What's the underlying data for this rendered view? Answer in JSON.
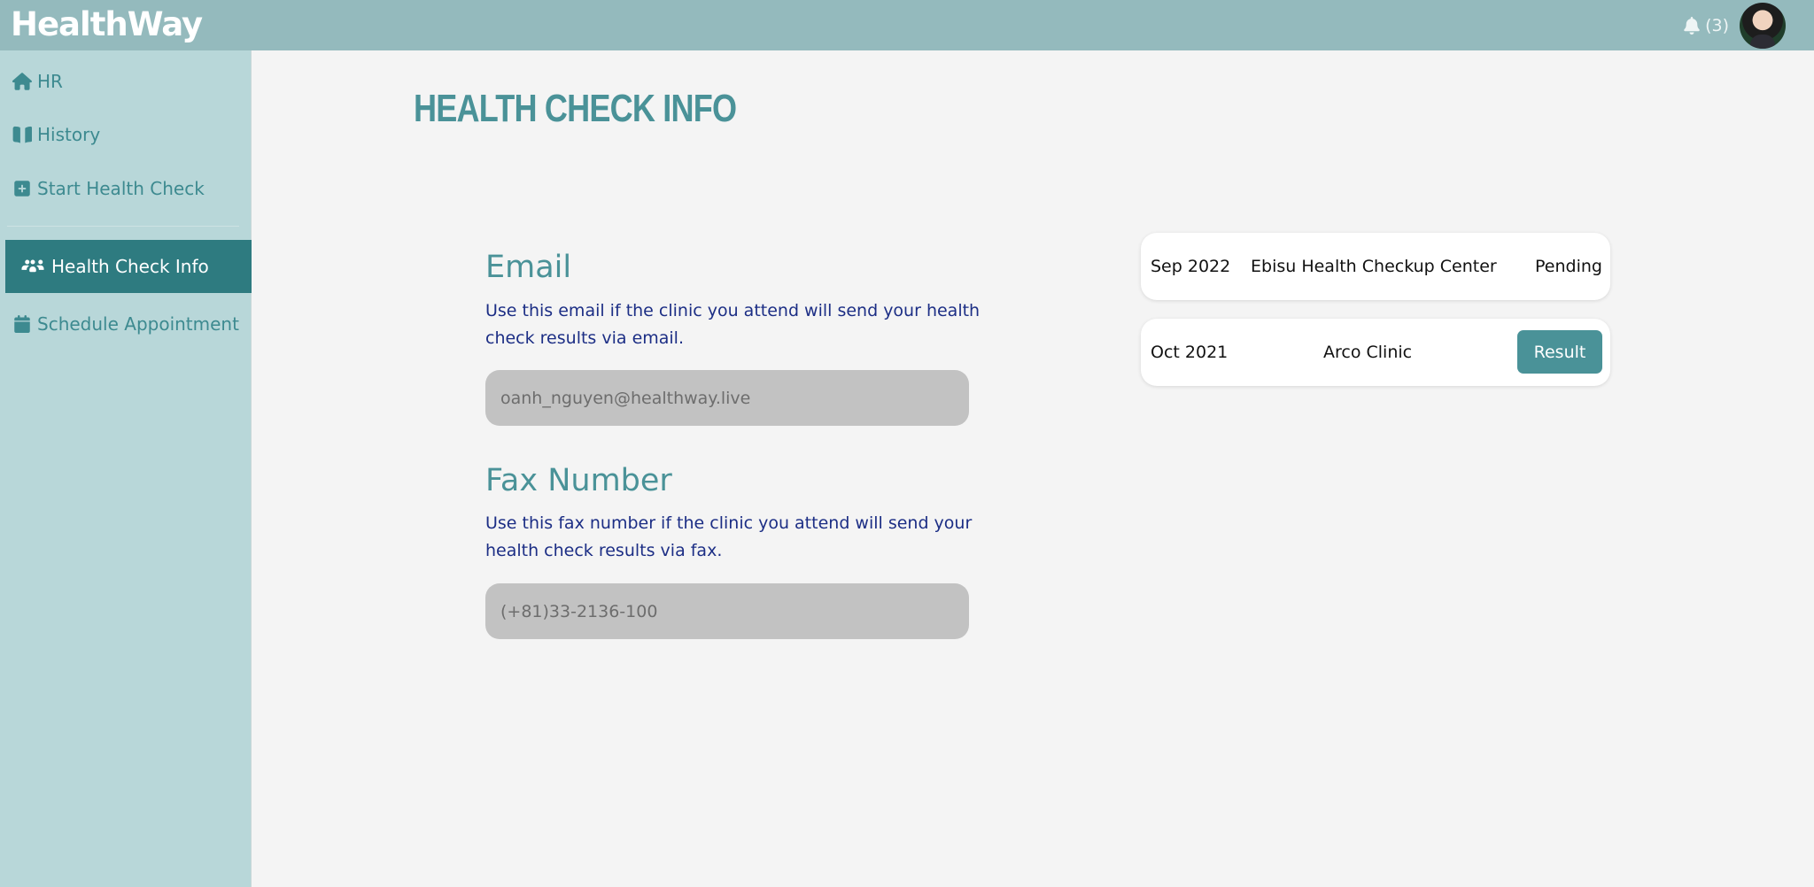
{
  "app": {
    "logo": "HealthWay"
  },
  "header": {
    "notification_count": "(3)",
    "avatar": "user-avatar"
  },
  "sidebar": {
    "items": [
      {
        "label": "HR",
        "icon": "home-icon"
      },
      {
        "label": "History",
        "icon": "book-icon"
      },
      {
        "label": "Start Health Check",
        "icon": "plus-square-icon"
      },
      {
        "label": "Health Check Info",
        "icon": "users-icon",
        "active": true
      },
      {
        "label": "Schedule Appointment",
        "icon": "calendar-icon"
      }
    ]
  },
  "main": {
    "title": "HEALTH CHECK INFO",
    "email": {
      "heading": "Email",
      "description": "Use this email if the clinic you attend will send your health check results via email.",
      "value": "oanh_nguyen@healthway.live"
    },
    "fax": {
      "heading": "Fax Number",
      "description": "Use this fax number if the clinic you attend will send your health check results via fax.",
      "value": "(+81)33-2136-100"
    },
    "records": [
      {
        "date": "Sep 2022",
        "clinic": "Ebisu Health Checkup Center",
        "status": "Pending"
      },
      {
        "date": "Oct 2021",
        "clinic": "Arco Clinic",
        "action": "Result"
      }
    ]
  },
  "colors": {
    "accent": "#4a9298",
    "sidebar_bg": "#b8d7d9",
    "topbar_bg": "#94babd",
    "active_bg": "#2e7b80",
    "description_text": "#1c2e85"
  }
}
